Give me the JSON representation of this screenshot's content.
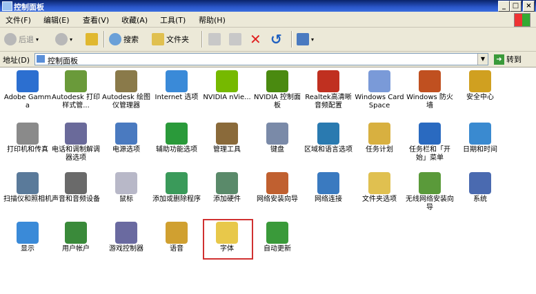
{
  "window": {
    "title": "控制面板",
    "buttons": [
      "_",
      "□",
      "×"
    ]
  },
  "menu": {
    "items": [
      "文件(F)",
      "编辑(E)",
      "查看(V)",
      "收藏(A)",
      "工具(T)",
      "帮助(H)"
    ]
  },
  "toolbar": {
    "back": "后退",
    "search": "搜索",
    "folders": "文件夹"
  },
  "address": {
    "label": "地址(D)",
    "value": "控制面板",
    "go": "转到"
  },
  "items": [
    {
      "label": "Adobe Gamma",
      "color": "#2c6fd0"
    },
    {
      "label": "Autodesk 打印样式管...",
      "color": "#6a9a3a"
    },
    {
      "label": "Autodesk 绘图仪管理器",
      "color": "#8a7a4a"
    },
    {
      "label": "Internet 选项",
      "color": "#3a8ad8"
    },
    {
      "label": "NVIDIA nVie...",
      "color": "#76b900"
    },
    {
      "label": "NVIDIA 控制面板",
      "color": "#4a8a10"
    },
    {
      "label": "Realtek高清晰音频配置",
      "color": "#c03020"
    },
    {
      "label": "Windows CardSpace",
      "color": "#7a9ad8"
    },
    {
      "label": "Windows 防火墙",
      "color": "#c05020"
    },
    {
      "label": "安全中心",
      "color": "#d0a020"
    },
    {
      "label": "打印机和传真",
      "color": "#8a8a8a"
    },
    {
      "label": "电话和调制解调器选项",
      "color": "#6a6a9a"
    },
    {
      "label": "电源选项",
      "color": "#4a7ac0"
    },
    {
      "label": "辅助功能选项",
      "color": "#2a9a3a"
    },
    {
      "label": "管理工具",
      "color": "#8a6a3a"
    },
    {
      "label": "键盘",
      "color": "#7a8aa8"
    },
    {
      "label": "区域和语言选项",
      "color": "#2a7ab0"
    },
    {
      "label": "任务计划",
      "color": "#d8b040"
    },
    {
      "label": "任务栏和「开始」菜单",
      "color": "#2a6ac0"
    },
    {
      "label": "日期和时间",
      "color": "#3a8ad0"
    },
    {
      "label": "扫描仪和照相机",
      "color": "#5a7a9a"
    },
    {
      "label": "声音和音频设备",
      "color": "#6a6a6a"
    },
    {
      "label": "鼠标",
      "color": "#b8b8c8"
    },
    {
      "label": "添加或删除程序",
      "color": "#3a9a5a"
    },
    {
      "label": "添加硬件",
      "color": "#5a8a6a"
    },
    {
      "label": "网络安装向导",
      "color": "#c06030"
    },
    {
      "label": "网络连接",
      "color": "#3a7ac0"
    },
    {
      "label": "文件夹选项",
      "color": "#e0c050"
    },
    {
      "label": "无线网络安装向导",
      "color": "#5a9a3a"
    },
    {
      "label": "系统",
      "color": "#4a6ab0"
    },
    {
      "label": "显示",
      "color": "#3a8ad8"
    },
    {
      "label": "用户帐户",
      "color": "#3a8a3a"
    },
    {
      "label": "游戏控制器",
      "color": "#6a6aa0"
    },
    {
      "label": "语音",
      "color": "#d0a030"
    },
    {
      "label": "字体",
      "color": "#e8c84a"
    },
    {
      "label": "自动更新",
      "color": "#3a9a3a"
    }
  ]
}
